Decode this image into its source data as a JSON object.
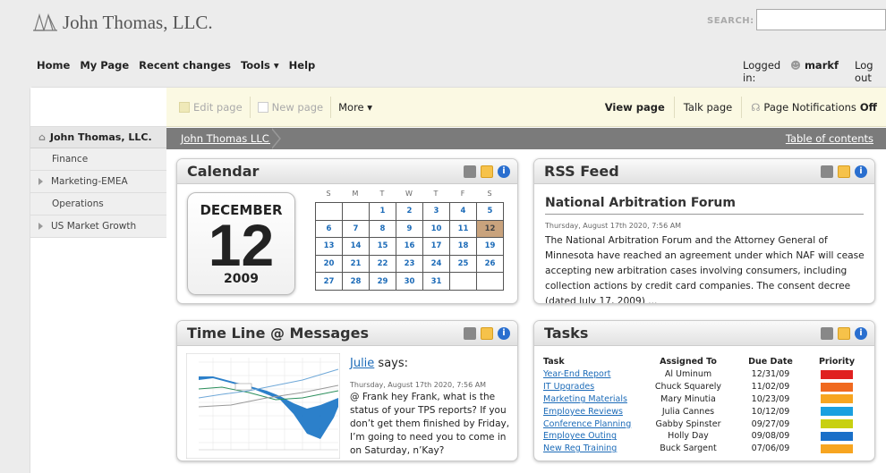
{
  "brand": {
    "name": "John Thomas, LLC."
  },
  "search": {
    "label": "SEARCH:",
    "value": ""
  },
  "topnav": {
    "items": [
      "Home",
      "My Page",
      "Recent changes",
      "Tools ▾",
      "Help"
    ]
  },
  "user": {
    "logged_in_label": "Logged in:",
    "username": "markf",
    "logout_label": "Log out"
  },
  "toolbar": {
    "edit_label": "Edit page",
    "new_label": "New page",
    "more_label": "More ▾",
    "view_label": "View page",
    "talk_label": "Talk page",
    "notif_label": "Page Notifications",
    "notif_state": "Off"
  },
  "sidebar": {
    "active": "John Thomas, LLC.",
    "items": [
      {
        "label": "Finance",
        "expandable": false
      },
      {
        "label": "Marketing-EMEA",
        "expandable": true
      },
      {
        "label": "Operations",
        "expandable": false
      },
      {
        "label": "US Market Growth",
        "expandable": true
      }
    ]
  },
  "breadcrumb": {
    "current": "John Thomas LLC.",
    "toc": "Table of contents"
  },
  "calendar": {
    "title": "Calendar",
    "month": "DECEMBER",
    "day": "12",
    "year": "2009",
    "dow": [
      "S",
      "M",
      "T",
      "W",
      "T",
      "F",
      "S"
    ],
    "weeks": [
      [
        "",
        "",
        "1",
        "2",
        "3",
        "4",
        "5"
      ],
      [
        "6",
        "7",
        "8",
        "9",
        "10",
        "11",
        "12"
      ],
      [
        "13",
        "14",
        "15",
        "16",
        "17",
        "18",
        "19"
      ],
      [
        "20",
        "21",
        "22",
        "23",
        "24",
        "25",
        "26"
      ],
      [
        "27",
        "28",
        "29",
        "30",
        "31",
        "",
        ""
      ]
    ],
    "today": "12"
  },
  "rss": {
    "title": "RSS Feed",
    "headline": "National Arbitration Forum",
    "date": "Thursday, August 17th 2020, 7:56 AM",
    "body": "The National Arbitration Forum and the Attorney General of Minnesota have reached an agreement under which NAF will cease accepting new arbitration cases involving consumers, including collection actions by credit card companies. The consent decree (dated July 17, 2009) ..."
  },
  "timeline": {
    "title": "Time Line @ Messages",
    "user": "Julie",
    "says": " says:",
    "date": "Thursday, August 17th 2020, 7:56 AM",
    "message": "@ Frank hey Frank, what is the status of your TPS reports? If you don’t get them finished by Friday, I’m going to need you to come in on Saturday, n’Kay?"
  },
  "tasks": {
    "title": "Tasks",
    "headers": [
      "Task",
      "Assigned To",
      "Due Date",
      "Priority"
    ],
    "rows": [
      {
        "task": "Year-End Report",
        "assigned": "Al Uminum",
        "due": "12/31/09",
        "color": "#e02020"
      },
      {
        "task": "IT Upgrades",
        "assigned": "Chuck Squarely",
        "due": "11/02/09",
        "color": "#f06a20"
      },
      {
        "task": "Marketing Materials",
        "assigned": "Mary Minutia",
        "due": "10/23/09",
        "color": "#f7a520"
      },
      {
        "task": "Employee Reviews",
        "assigned": "Julia Cannes",
        "due": "10/12/09",
        "color": "#1aa0e0"
      },
      {
        "task": "Conference Planning",
        "assigned": "Gabby Spinster",
        "due": "09/27/09",
        "color": "#c8d010"
      },
      {
        "task": "Employee Outing",
        "assigned": "Holly Day",
        "due": "09/08/09",
        "color": "#1a6fc8"
      },
      {
        "task": "New Reg Training",
        "assigned": "Buck Sargent",
        "due": "07/06/09",
        "color": "#f7a520"
      }
    ]
  }
}
